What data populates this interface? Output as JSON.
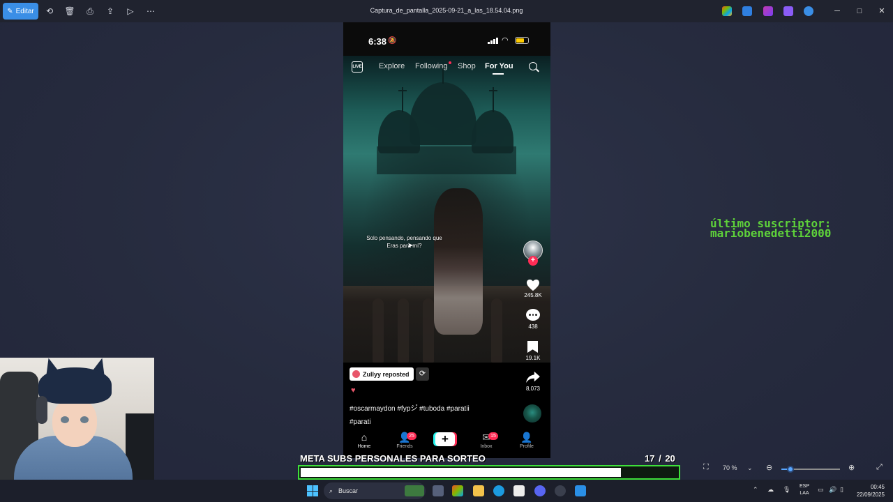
{
  "window": {
    "title": "Captura_de_pantalla_2025-09-21_a_las_18.54.04.png",
    "edit_label": "Editar",
    "min": "─",
    "max": "□",
    "close": "✕"
  },
  "toolbar_icons": [
    "rotate-icon",
    "delete-icon",
    "print-icon",
    "share-icon",
    "slideshow-icon",
    "more-icon"
  ],
  "phone": {
    "status_time": "6:38",
    "battery_color": "#ffcc00",
    "nav": {
      "live": "LIVE",
      "explore": "Explore",
      "following": "Following",
      "shop": "Shop",
      "for_you": "For You"
    },
    "lyrics": [
      "Solo pensando, pensando que",
      "Eras para mí?"
    ],
    "actions": {
      "likes": "245.8K",
      "comments": "438",
      "saves": "19.1K",
      "shares": "8,073"
    },
    "repost_label": "Zullyy reposted",
    "caption_line1": "#oscarmaydon #fypシ゚ #tuboda #paratii",
    "caption_line2": "#parati",
    "bottom_nav": {
      "home": "Home",
      "friends": "Friends",
      "friends_badge": "25",
      "inbox": "Inbox",
      "inbox_badge": "15",
      "profile": "Profile"
    },
    "accent": "#fe2c55"
  },
  "overlay": {
    "subscriber_line1": "último suscriptor:",
    "subscriber_line2": "mariobenedetti2000",
    "subscriber_color": "#5ed23a"
  },
  "goal": {
    "title": "META SUBS PERSONALES PARA SORTEO",
    "current": "17",
    "total": "/ 20",
    "progress": 0.85,
    "bar_color": "#3ee03a"
  },
  "zoom": {
    "level": "70 %",
    "slider_value": 0.15
  },
  "taskbar": {
    "search_placeholder": "Buscar",
    "lang_line1": "ESP",
    "lang_line2": "LAA",
    "time": "00:45",
    "date": "22/09/2025"
  }
}
